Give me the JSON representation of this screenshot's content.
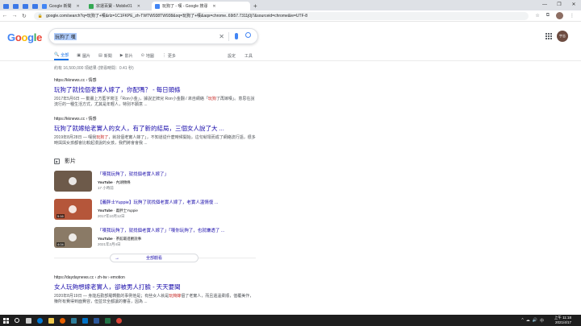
{
  "browser": {
    "tabs": [
      {
        "label": "Google 新聞",
        "color": "#4285f4",
        "active": false
      },
      {
        "label": "宗運百寶 - Mobile01",
        "color": "#34a853",
        "active": false
      },
      {
        "label": "玩狗了 - 嘆 - Google 搜尋",
        "color": "#4285f4",
        "active": true
      }
    ],
    "new_tab": "+",
    "url": "google.com/search?q=玩狗了+嘆&rlz=1C1FKPE_zh-TWTW938TW938&oq=玩狗了+嘆&aqs=chrome..69i57.7311j0j7&sourceid=chrome&ie=UTF-8",
    "window_controls": [
      "—",
      "❐",
      "✕"
    ]
  },
  "search": {
    "query": "玩狗了 嘆",
    "logo": [
      "G",
      "o",
      "o",
      "g",
      "l",
      "e"
    ],
    "avatar_text": "宇志"
  },
  "nav": {
    "tabs": [
      {
        "icon": "🔍",
        "label": "全部",
        "active": true
      },
      {
        "icon": "▣",
        "label": "圖片",
        "active": false
      },
      {
        "icon": "▤",
        "label": "新聞",
        "active": false
      },
      {
        "icon": "▶",
        "label": "影片",
        "active": false
      },
      {
        "icon": "⊙",
        "label": "地圖",
        "active": false
      },
      {
        "icon": "⋮",
        "label": "更多",
        "active": false
      }
    ],
    "settings": "設定",
    "tools": "工具"
  },
  "stats": "約有 16,500,000 項結果 (搜尋時間：0.41 秒)",
  "results": [
    {
      "url": "https://kknews.cc › 情感",
      "title": "玩狗了就找個老實人嫁了，你配嗎？ - 每日頭條",
      "date": "2017年5月6日 — ",
      "snippet_a": "動畫上方藍字寫注「Ron小金」，據說正牌兒 Ron小金翻 / 來自網絡「",
      "highlight": "玩狗",
      "snippet_b": "了再嫁嘆」。意思在說流行的一種生活方式，尤其是年輕人，特別不願意 ..."
    },
    {
      "url": "https://kknews.cc › 情感",
      "title": "玩狗了就嫁給老實人的女人，有了新的結局，三個女人說了大 ...",
      "date": "2019年8月28日 — ",
      "snippet_a": "嘆我",
      "highlight": "玩狗了",
      "snippet_b": "，就找個老實人嫁了」，不知道從什麼時候開始，這句就壞而成了網絡流行語，很多時與與女孩都會比較起漫說的女孩，我們將會會我 ..."
    },
    {
      "url": "https://daydaynews.cc › zh-tw › emotion",
      "title": "女人玩夠想嫁老實人，卻被男人打臉 - 天天要聞",
      "date": "2020年8月19日 — ",
      "snippet_a": "身能后勤部羅轉動的事例他是；有些女人就是",
      "highlight": "玩夠嫁",
      "snippet_b": "個了老實人，而且還溫柔順，值覆美作，賺所有費得到面費容，但並非全都讓的審喜，因為 ..."
    }
  ],
  "videos": {
    "heading": "影片",
    "items": [
      {
        "title": "「嘆我玩夠了，就找個老實人嫁了」",
        "source": "YouTube",
        "channel": "內湖頻條",
        "date": "17 小時前",
        "duration": "",
        "thumb": "#6d5a4a"
      },
      {
        "title": "【義胖士Yuppie】玩夠了就找個老實人嫁了，老實人溫情復 ...",
        "source": "YouTube",
        "channel": "義胖士Yuppie",
        "date": "2017年10月12日",
        "duration": "5:16",
        "thumb": "#b5563a"
      },
      {
        "title": "「嘆我玩夠了，就找個老實人嫁了」「嘆你玩夠了，也就嫌透了 ...",
        "source": "YouTube",
        "channel": "茶館最進觀說事",
        "date": "2021年2月4日",
        "duration": "4:04",
        "thumb": "#8a7a66"
      }
    ],
    "view_all": "全部觀看"
  },
  "taskbar": {
    "time": "上午 11:18",
    "date": "2021/4/17",
    "icons": [
      {
        "name": "search",
        "color": "#ffffff"
      },
      {
        "name": "task-view",
        "color": "#cccccc"
      },
      {
        "name": "edge",
        "color": "#0078d4"
      },
      {
        "name": "explorer",
        "color": "#f2c94c"
      },
      {
        "name": "firefox",
        "color": "#e66000"
      },
      {
        "name": "store",
        "color": "#2d7d9a"
      },
      {
        "name": "mail",
        "color": "#0072c6"
      },
      {
        "name": "word",
        "color": "#2b579a"
      },
      {
        "name": "excel",
        "color": "#217346"
      },
      {
        "name": "chrome",
        "color": "#db4437"
      }
    ],
    "tray": [
      "^",
      "☁",
      "🔊",
      "中"
    ]
  },
  "colors": {
    "link": "#1a0dab",
    "accent": "#1a73e8",
    "taskbar": "#1e1e1e"
  }
}
